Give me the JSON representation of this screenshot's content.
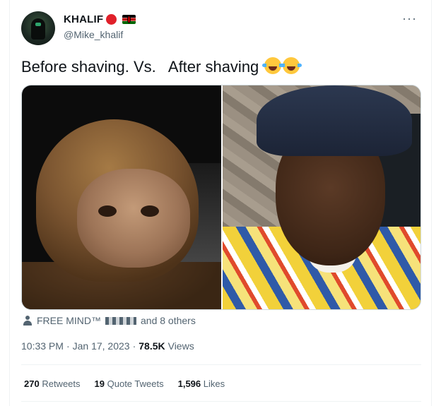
{
  "author": {
    "name": "KHALIF",
    "handle": "@Mike_khalif"
  },
  "tweet": {
    "text": "Before shaving. Vs.   After shaving",
    "emojis": [
      "face-with-tears-of-joy",
      "face-with-tears-of-joy"
    ]
  },
  "media": {
    "left_image": "ape-photo",
    "right_image": "man-in-cap-photo"
  },
  "liked_by": {
    "first": "FREE MIND™",
    "rest": "and 8 others"
  },
  "meta": {
    "time": "10:33 PM",
    "separator1": "·",
    "date": "Jan 17, 2023",
    "separator2": "·",
    "views_count": "78.5K",
    "views_label": "Views"
  },
  "stats": {
    "retweets_count": "270",
    "retweets_label": "Retweets",
    "quotes_count": "19",
    "quotes_label": "Quote Tweets",
    "likes_count": "1,596",
    "likes_label": "Likes"
  },
  "more_glyph": "···",
  "colors": {
    "text": "#0f1419",
    "secondary": "#536471",
    "divider": "#eff3f4"
  }
}
